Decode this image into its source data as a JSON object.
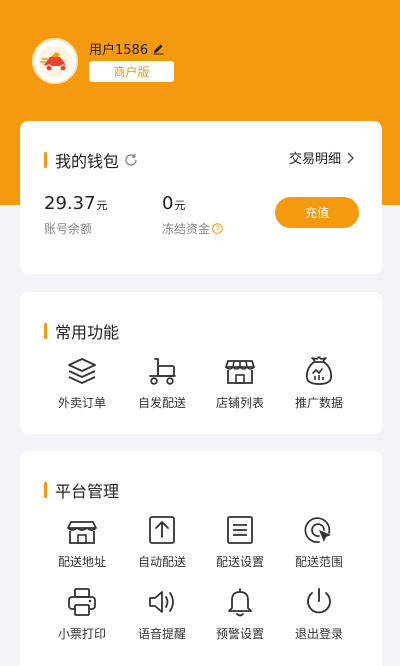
{
  "profile": {
    "username": "用户1586",
    "role_badge": "商户版",
    "avatar_icon": "delivery-scooter-logo",
    "edit_icon": "pencil-icon"
  },
  "wallet": {
    "title": "我的钱包",
    "detail_link": "交易明细",
    "balance_value": "29.37",
    "balance_unit": "元",
    "balance_label": "账号余额",
    "frozen_value": "0",
    "frozen_unit": "元",
    "frozen_label": "冻结资金",
    "recharge_button": "充值"
  },
  "common_functions": {
    "title": "常用功能",
    "items": [
      {
        "label": "外卖订单",
        "icon": "layers-icon"
      },
      {
        "label": "自发配送",
        "icon": "delivery-cart-icon"
      },
      {
        "label": "店铺列表",
        "icon": "store-icon"
      },
      {
        "label": "推广数据",
        "icon": "chart-bag-icon"
      }
    ]
  },
  "platform_management": {
    "title": "平台管理",
    "items": [
      {
        "label": "配送地址",
        "icon": "shop-address-icon"
      },
      {
        "label": "自动配送",
        "icon": "upload-icon"
      },
      {
        "label": "配送设置",
        "icon": "document-icon"
      },
      {
        "label": "配送范围",
        "icon": "range-pointer-icon"
      },
      {
        "label": "小票打印",
        "icon": "printer-icon"
      },
      {
        "label": "语音提醒",
        "icon": "speaker-icon"
      },
      {
        "label": "预警设置",
        "icon": "bell-icon"
      },
      {
        "label": "退出登录",
        "icon": "power-icon"
      }
    ]
  },
  "colors": {
    "accent": "#f59a0f",
    "background": "#f4f4f6"
  }
}
